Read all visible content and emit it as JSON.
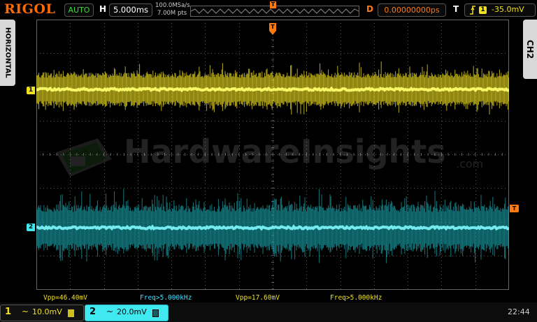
{
  "header": {
    "logo": "RIGOL",
    "trigger_mode": "AUTO",
    "timebase_label": "H",
    "timebase_value": "5.000ms",
    "sample_rate": "100.0MSa/s",
    "memory_depth": "7.00M pts",
    "trigger_marker": "T",
    "delay_label": "D",
    "delay_value": "0.00000000ps",
    "trigger_label": "T",
    "trigger_channel": "1",
    "trigger_level": "-35.0mV"
  },
  "side": {
    "left_tab": "HORIZONTAL",
    "right_tab": "CH2"
  },
  "markers": {
    "ch1": "1",
    "ch2": "2",
    "trigger_level_marker": "T",
    "trigger_position_marker": "T"
  },
  "watermark": {
    "text": "HardwareInsights",
    "suffix": ".com"
  },
  "measurements": [
    {
      "text": "Vpp=46.40mV",
      "color": "#f0e020"
    },
    {
      "text": "Freq>5.000kHz",
      "color": "#40e0ff"
    },
    {
      "text": "Vpp=17.60mV",
      "color": "#f0e020"
    },
    {
      "text": "Freq>5.000kHz",
      "color": "#f0e020"
    }
  ],
  "channels": [
    {
      "number": "1",
      "coupling": "~",
      "scale": "10.0mV",
      "color": "#f0e020"
    },
    {
      "number": "2",
      "coupling": "~",
      "scale": "20.0mV",
      "color": "#40e8f0"
    }
  ],
  "clock": "22:44",
  "colors": {
    "ch1": "#f0e020",
    "ch2": "#40e8f0",
    "accent": "#ff7a10",
    "status": "#3ddc3d"
  }
}
